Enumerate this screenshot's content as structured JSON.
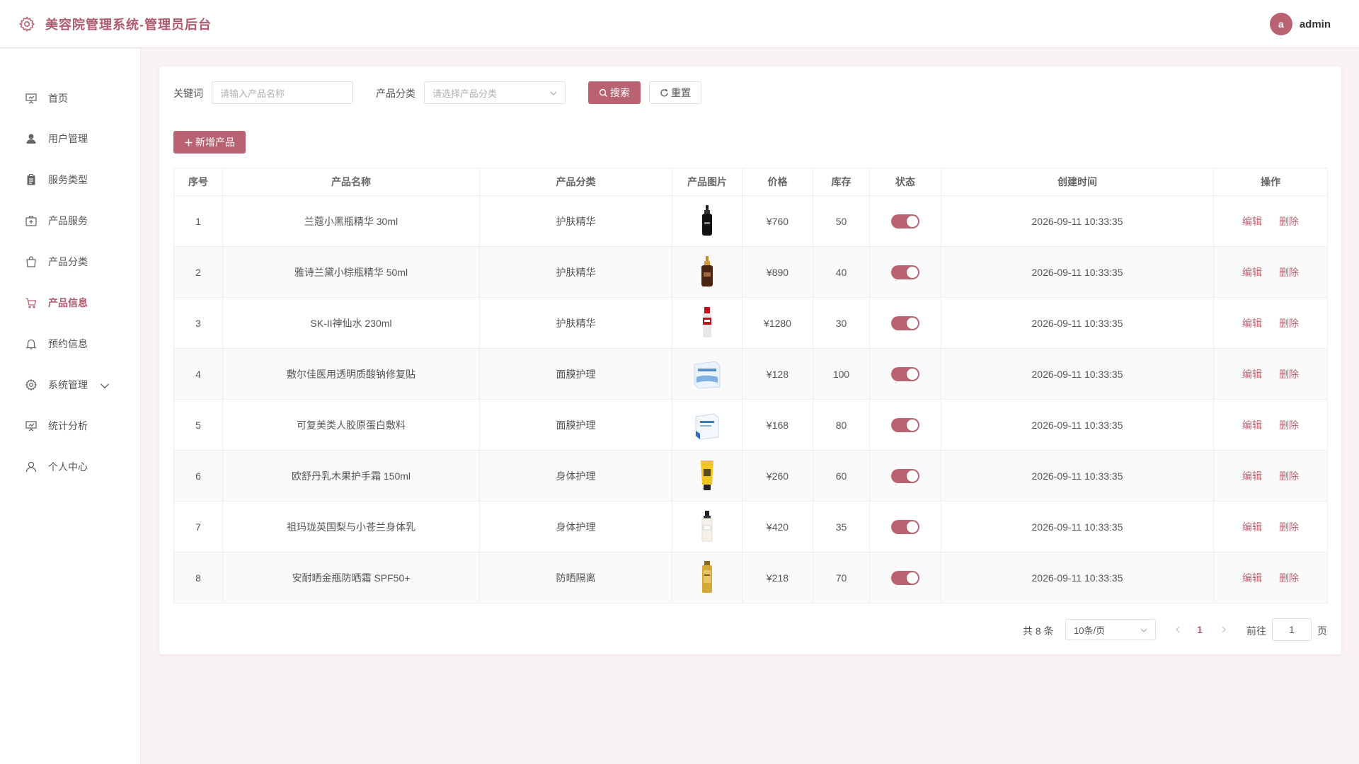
{
  "header": {
    "app_title": "美容院管理系统-管理员后台",
    "avatar_letter": "a",
    "username": "admin"
  },
  "sidebar": {
    "items": [
      {
        "label": "首页",
        "icon": "presentation-icon"
      },
      {
        "label": "用户管理",
        "icon": "user-icon"
      },
      {
        "label": "服务类型",
        "icon": "clipboard-icon"
      },
      {
        "label": "产品服务",
        "icon": "first-aid-kit-icon"
      },
      {
        "label": "产品分类",
        "icon": "shopping-bag-icon"
      },
      {
        "label": "产品信息",
        "icon": "shopping-cart-icon",
        "active": true
      },
      {
        "label": "预约信息",
        "icon": "bell-icon"
      },
      {
        "label": "系统管理",
        "icon": "gear-icon",
        "expandable": true
      },
      {
        "label": "统计分析",
        "icon": "presentation-icon"
      },
      {
        "label": "个人中心",
        "icon": "user-outline-icon"
      }
    ]
  },
  "filters": {
    "keyword_label": "关键词",
    "keyword_placeholder": "请输入产品名称",
    "category_label": "产品分类",
    "category_placeholder": "请选择产品分类",
    "search_label": "搜索",
    "reset_label": "重置"
  },
  "toolbar": {
    "add_label": "新增产品"
  },
  "table": {
    "columns": [
      "序号",
      "产品名称",
      "产品分类",
      "产品图片",
      "价格",
      "库存",
      "状态",
      "创建时间",
      "操作"
    ],
    "rows": [
      {
        "no": "1",
        "name": "兰蔻小黑瓶精华 30ml",
        "category": "护肤精华",
        "price": "¥760",
        "stock": "50",
        "status_on": true,
        "created": "2026-09-11 10:33:35",
        "image": "black-serum-bottle"
      },
      {
        "no": "2",
        "name": "雅诗兰黛小棕瓶精华 50ml",
        "category": "护肤精华",
        "price": "¥890",
        "stock": "40",
        "status_on": true,
        "created": "2026-09-11 10:33:35",
        "image": "brown-dropper-bottle"
      },
      {
        "no": "3",
        "name": "SK-II神仙水 230ml",
        "category": "护肤精华",
        "price": "¥1280",
        "stock": "30",
        "status_on": true,
        "created": "2026-09-11 10:33:35",
        "image": "red-essence-bottle"
      },
      {
        "no": "4",
        "name": "敷尔佳医用透明质酸钠修复贴",
        "category": "面膜护理",
        "price": "¥128",
        "stock": "100",
        "status_on": true,
        "created": "2026-09-11 10:33:35",
        "image": "mask-box"
      },
      {
        "no": "5",
        "name": "可复美类人胶原蛋白敷料",
        "category": "面膜护理",
        "price": "¥168",
        "stock": "80",
        "status_on": true,
        "created": "2026-09-11 10:33:35",
        "image": "mask-box"
      },
      {
        "no": "6",
        "name": "欧舒丹乳木果护手霜 150ml",
        "category": "身体护理",
        "price": "¥260",
        "stock": "60",
        "status_on": true,
        "created": "2026-09-11 10:33:35",
        "image": "yellow-tube"
      },
      {
        "no": "7",
        "name": "祖玛珑英国梨与小苍兰身体乳",
        "category": "身体护理",
        "price": "¥420",
        "stock": "35",
        "status_on": true,
        "created": "2026-09-11 10:33:35",
        "image": "white-lotion-bottle"
      },
      {
        "no": "8",
        "name": "安耐晒金瓶防晒霜 SPF50+",
        "category": "防晒隔离",
        "price": "¥218",
        "stock": "70",
        "status_on": true,
        "created": "2026-09-11 10:33:35",
        "image": "gold-sunscreen-bottle"
      }
    ],
    "edit_label": "编辑",
    "delete_label": "删除"
  },
  "pagination": {
    "total_text": "共 8 条",
    "page_size": "10条/页",
    "current_page": "1",
    "goto_label": "前往",
    "goto_value": "1",
    "page_suffix": "页"
  },
  "colors": {
    "accent": "#b96271",
    "title": "#b05a6c",
    "background": "#f9f2f3"
  }
}
